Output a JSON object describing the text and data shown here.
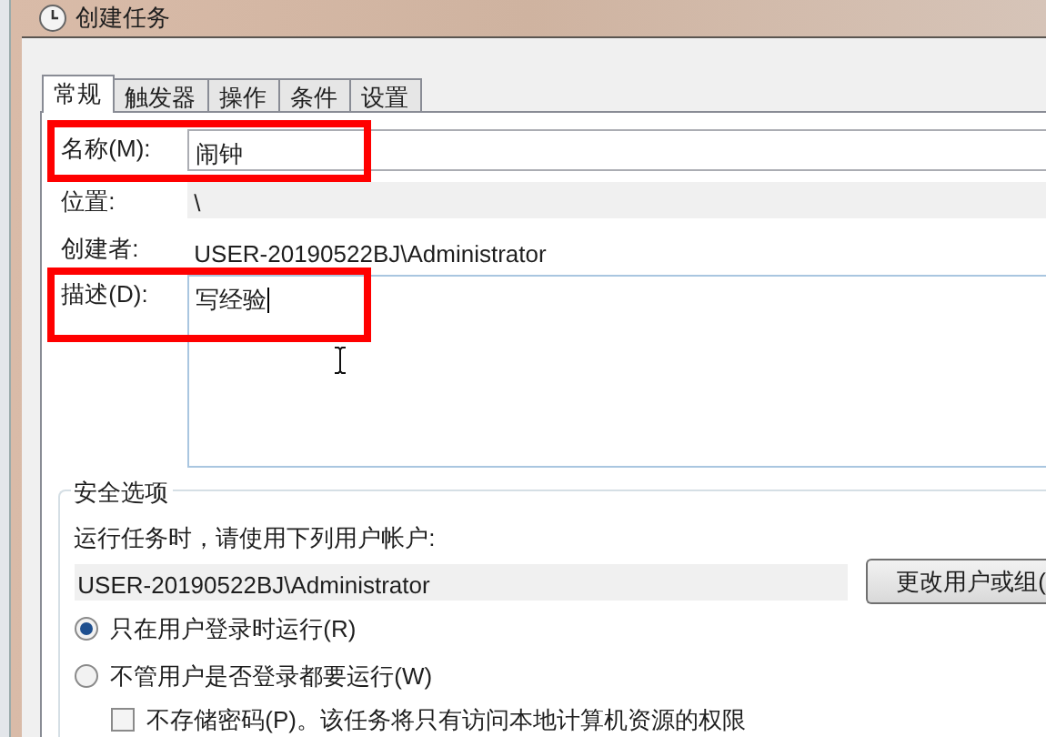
{
  "window": {
    "title": "创建任务"
  },
  "tabs": [
    {
      "label": "常规",
      "selected": true
    },
    {
      "label": "触发器",
      "selected": false
    },
    {
      "label": "操作",
      "selected": false
    },
    {
      "label": "条件",
      "selected": false
    },
    {
      "label": "设置",
      "selected": false
    }
  ],
  "general": {
    "name": {
      "label": "名称(M):",
      "value": "闹钟"
    },
    "location": {
      "label": "位置:",
      "value": "\\"
    },
    "author": {
      "label": "创建者:",
      "value": "USER-20190522BJ\\Administrator"
    },
    "description": {
      "label": "描述(D):",
      "value": "写经验"
    }
  },
  "security": {
    "title": "安全选项",
    "prompt": "运行任务时，请使用下列用户帐户:",
    "account": "USER-20190522BJ\\Administrator",
    "change_button": "更改用户或组(",
    "options": [
      {
        "label": "只在用户登录时运行(R)",
        "selected": true
      },
      {
        "label": "不管用户是否登录都要运行(W)",
        "selected": false
      }
    ],
    "no_password": {
      "label": "不存储密码(P)。该任务将只有访问本地计算机资源的权限",
      "checked": false
    }
  }
}
